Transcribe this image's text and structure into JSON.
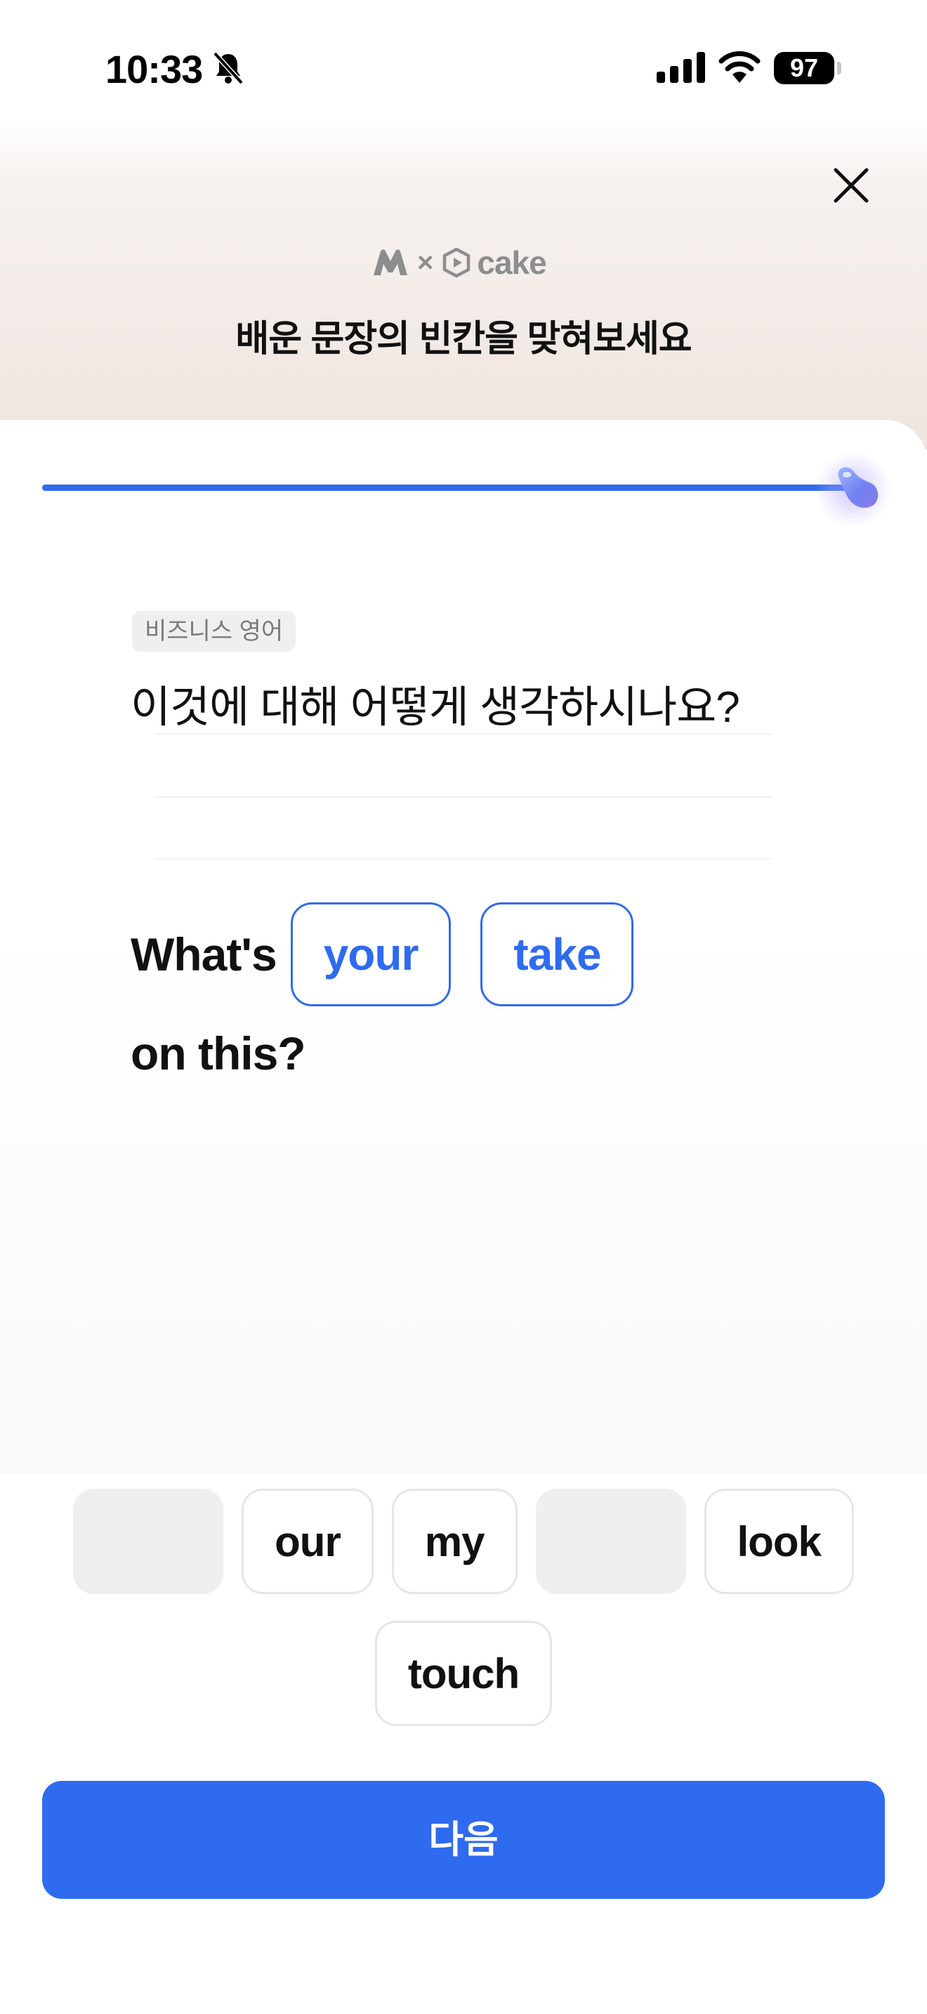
{
  "status_bar": {
    "time": "10:33",
    "battery": "97",
    "icons": [
      "bell-muted-icon",
      "cellular-signal-icon",
      "wifi-icon",
      "battery-icon"
    ]
  },
  "header": {
    "close_icon": "close-icon",
    "brand": {
      "separator": "×",
      "partner_name": "cake"
    },
    "title": "배운 문장의 빈칸을 맞혀보세요"
  },
  "progress": {
    "value": 1.0,
    "color": "#2f6bef"
  },
  "question": {
    "category": "비즈니스 영어",
    "korean": "이것에 대해 어떻게 생각하시나요?",
    "english_prefix": "What's",
    "answers": [
      "your",
      "take"
    ],
    "english_suffix": "on this?"
  },
  "word_bank": {
    "row1": [
      {
        "label": "",
        "used": true
      },
      {
        "label": "our",
        "used": false
      },
      {
        "label": "my",
        "used": false
      },
      {
        "label": "",
        "used": true
      },
      {
        "label": "look",
        "used": false
      }
    ],
    "row2": [
      {
        "label": "touch",
        "used": false
      }
    ]
  },
  "footer": {
    "next_label": "다음"
  },
  "colors": {
    "accent": "#2f6bef",
    "text": "#111111",
    "muted": "#8d8d8d"
  }
}
